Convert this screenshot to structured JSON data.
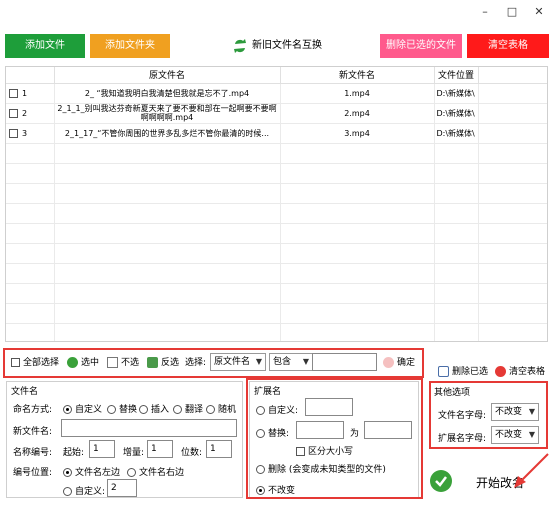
{
  "window": {
    "minimize": "–",
    "maximize": "□",
    "close": "✕"
  },
  "toolbar": {
    "add_file": "添加文件",
    "add_folder": "添加文件夹",
    "swap": "新旧文件名互换",
    "delete_selected": "删除已选的文件",
    "clear_table": "清空表格",
    "colors": {
      "add_file": "#1e9e3a",
      "add_folder": "#f0a020",
      "delete_selected": "#ff5a8c",
      "clear_table": "#ff1a1a"
    }
  },
  "table": {
    "headers": {
      "orig": "原文件名",
      "new": "新文件名",
      "pos": "文件位置"
    },
    "rows": [
      {
        "idx": "1",
        "orig": "2_ “我知道我明白我清楚但我就是忘不了.mp4",
        "new": "1.mp4",
        "pos": "D:\\新媒体\\"
      },
      {
        "idx": "2",
        "orig": "2_1_1_别叫我达芬奇新夏天来了要不要和部在一起啊要不要啊啊啊啊啊.mp4",
        "new": "2.mp4",
        "pos": "D:\\新媒体\\"
      },
      {
        "idx": "3",
        "orig": "2_1_17_“不管你周围的世界多乱多烂不管你最清的时候...",
        "new": "3.mp4",
        "pos": "D:\\新媒体\\"
      }
    ]
  },
  "selbar": {
    "select_all": "全部选择",
    "select": "选中",
    "unselect": "不选",
    "invert": "反选",
    "choose": "选择:",
    "field_value": "原文件名",
    "match_value": "包含",
    "filter_value": "",
    "confirm": "确定",
    "delete_selected": "删除已选",
    "clear_table": "清空表格"
  },
  "filename": {
    "title": "文件名",
    "mode_label": "命名方式:",
    "modes": [
      "自定义",
      "替换",
      "插入",
      "翻译",
      "随机"
    ],
    "new_name_label": "新文件名:",
    "new_name_value": "",
    "numbering_label": "名称编号:",
    "start_label": "起始:",
    "start_value": "1",
    "step_label": "增量:",
    "step_value": "1",
    "digits_label": "位数:",
    "digits_value": "1",
    "pos_label": "编号位置:",
    "pos_left": "文件名左边",
    "pos_right": "文件名右边",
    "pos_custom": "自定义:",
    "pos_custom_value": "2"
  },
  "ext": {
    "title": "扩展名",
    "custom": "自定义:",
    "custom_value": "",
    "replace": "替换:",
    "replace_value": "",
    "to": "为",
    "to_value": "",
    "case": "区分大小写",
    "delete": "删除 (会变成未知类型的文件)",
    "unchanged": "不改变"
  },
  "other": {
    "title": "其他选项",
    "name_case_label": "文件名字母:",
    "name_case_value": "不改变",
    "ext_case_label": "扩展名字母:",
    "ext_case_value": "不改变"
  },
  "start": {
    "label": "开始改名"
  }
}
